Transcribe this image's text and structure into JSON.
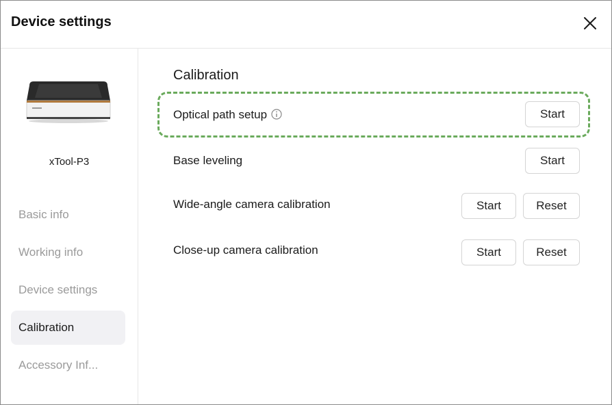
{
  "dialog": {
    "title": "Device settings",
    "close_icon": "close-icon"
  },
  "sidebar": {
    "device_name": "xTool-P3",
    "device_image": "laser-device-image",
    "items": [
      {
        "label": "Basic info",
        "active": false
      },
      {
        "label": "Working info",
        "active": false
      },
      {
        "label": "Device settings",
        "active": false
      },
      {
        "label": "Calibration",
        "active": true
      },
      {
        "label": "Accessory Inf...",
        "active": false
      }
    ]
  },
  "main": {
    "section_title": "Calibration",
    "rows": [
      {
        "label": "Optical path setup",
        "info_icon": "info-icon",
        "buttons": [
          "Start"
        ],
        "highlighted": true
      },
      {
        "label": "Base leveling",
        "buttons": [
          "Start"
        ]
      },
      {
        "label": "Wide-angle camera calibration",
        "buttons": [
          "Start",
          "Reset"
        ]
      },
      {
        "label": "Close-up camera calibration",
        "buttons": [
          "Start",
          "Reset"
        ]
      }
    ]
  },
  "colors": {
    "highlight": "#6aaa5c",
    "active_nav_bg": "#f1f1f4",
    "inactive_nav_text": "#9a9a9a"
  }
}
